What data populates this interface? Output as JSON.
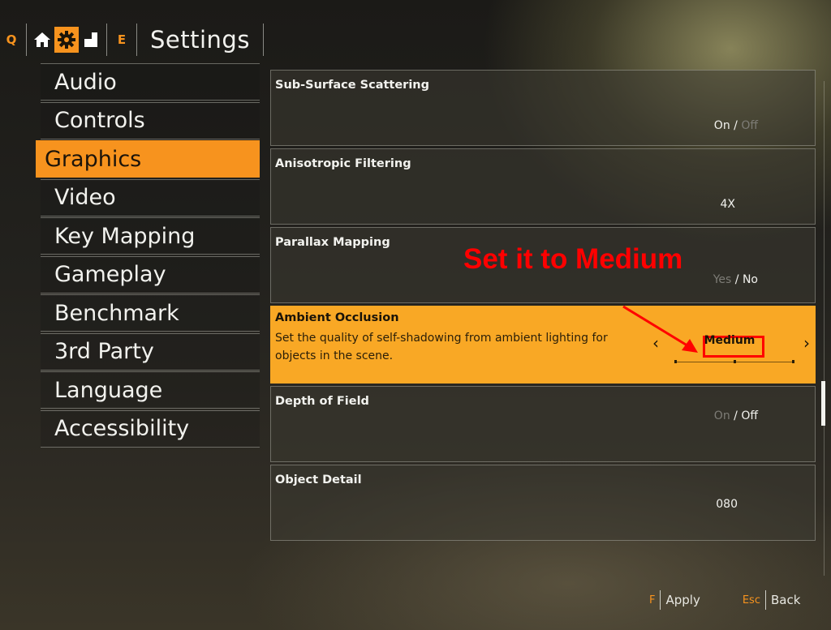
{
  "topbar": {
    "left_key": "Q",
    "right_key": "E",
    "title": "Settings",
    "tabs": [
      {
        "icon": "home-icon",
        "active": false
      },
      {
        "icon": "gear-icon",
        "active": true
      },
      {
        "icon": "document-icon",
        "active": false
      }
    ]
  },
  "sidebar": {
    "items": [
      {
        "label": "Audio",
        "active": false
      },
      {
        "label": "Controls",
        "active": false
      },
      {
        "label": "Graphics",
        "active": true
      },
      {
        "label": "Video",
        "active": false
      },
      {
        "label": "Key Mapping",
        "active": false
      },
      {
        "label": "Gameplay",
        "active": false
      },
      {
        "label": "Benchmark",
        "active": false
      },
      {
        "label": "3rd Party",
        "active": false
      },
      {
        "label": "Language",
        "active": false
      },
      {
        "label": "Accessibility",
        "active": false
      }
    ]
  },
  "settings": [
    {
      "name": "Sub-Surface Scattering",
      "opt_a": "On",
      "opt_b": "Off",
      "selected": "On"
    },
    {
      "name": "Anisotropic Filtering",
      "value": "4X"
    },
    {
      "name": "Parallax Mapping",
      "opt_a": "Yes",
      "opt_b": "No",
      "selected": "No"
    },
    {
      "name": "Ambient Occlusion",
      "description": "Set the quality of self-shadowing from ambient lighting for objects in the scene.",
      "value": "Medium",
      "slider_position": 0.5,
      "active": true
    },
    {
      "name": "Depth of Field",
      "opt_a": "On",
      "opt_b": "Off",
      "selected": "Off"
    },
    {
      "name": "Object Detail",
      "value": "080"
    }
  ],
  "annotation": "Set it to Medium",
  "footer": {
    "apply_key": "F",
    "apply_label": "Apply",
    "back_key": "Esc",
    "back_label": "Back"
  },
  "colors": {
    "accent": "#f7931e",
    "highlight": "#f9a825",
    "annotation": "#ff0000"
  }
}
